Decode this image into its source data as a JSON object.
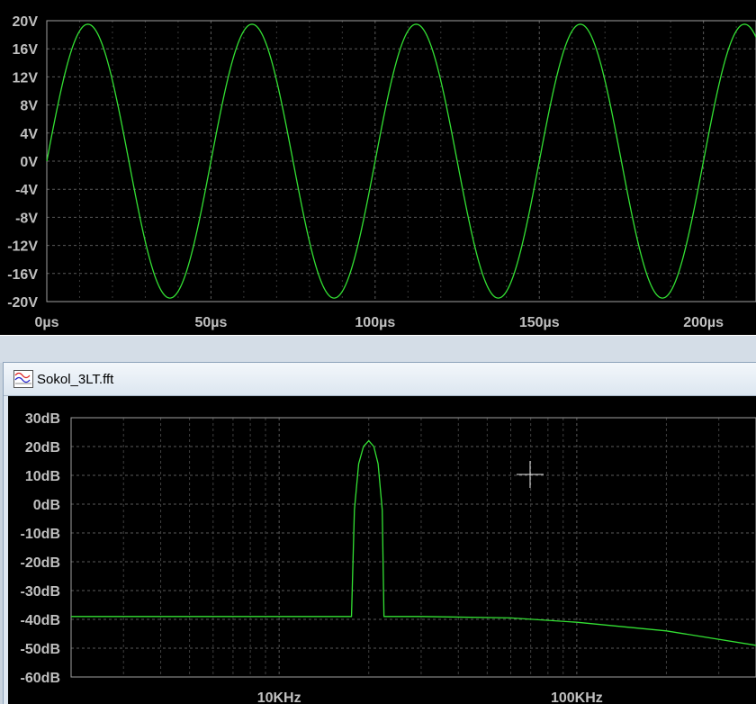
{
  "colors": {
    "background": "#000000",
    "trace": "#33e033",
    "grid": "#5a5a5a",
    "tick_text": "#c0c0c0"
  },
  "fft_window": {
    "title": "Sokol_3LT.fft",
    "icon": "waveform-icon"
  },
  "chart_data": [
    {
      "type": "line",
      "name": "transient-plot",
      "xlabel": "",
      "ylabel": "",
      "x_ticks": [
        "0µs",
        "50µs",
        "100µs",
        "150µs",
        "200µs"
      ],
      "y_ticks": [
        "20V",
        "16V",
        "12V",
        "8V",
        "4V",
        "0V",
        "-4V",
        "-8V",
        "-12V",
        "-16V",
        "-20V"
      ],
      "xlim_us": [
        0,
        216
      ],
      "ylim_v": [
        -20,
        20
      ],
      "grid": true,
      "series": [
        {
          "waveform": "sine",
          "amplitude_v": 19.5,
          "period_us": 50,
          "phase_start_v": 0
        }
      ]
    },
    {
      "type": "line",
      "name": "fft-plot",
      "xlabel": "",
      "ylabel": "",
      "x_scale": "log",
      "x_ticks": [
        "10KHz",
        "100KHz"
      ],
      "y_ticks": [
        "30dB",
        "20dB",
        "10dB",
        "0dB",
        "-10dB",
        "-20dB",
        "-30dB",
        "-40dB",
        "-50dB",
        "-60dB"
      ],
      "xlim_hz": [
        2000,
        400000
      ],
      "ylim_db": [
        -60,
        30
      ],
      "grid": true,
      "series": [
        {
          "x_hz": [
            2000,
            17500,
            17900,
            18500,
            19200,
            20000,
            20800,
            21500,
            22200,
            22500,
            30000,
            60000,
            100000,
            200000,
            400000
          ],
          "y_db": [
            -39,
            -39,
            -2,
            14,
            20,
            22,
            20,
            14,
            -2,
            -39,
            -39,
            -39.5,
            -41,
            -44,
            -49
          ]
        }
      ]
    }
  ]
}
